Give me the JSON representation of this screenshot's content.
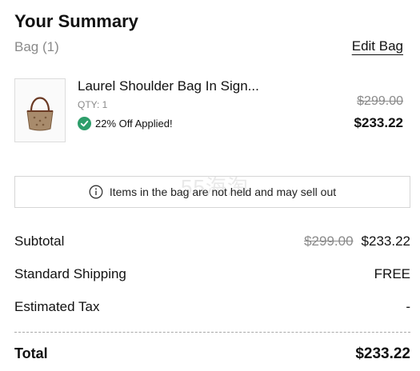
{
  "summary": {
    "title": "Your Summary",
    "bag_count_label": "Bag (1)",
    "edit_bag_label": "Edit Bag"
  },
  "item": {
    "name": "Laurel Shoulder Bag In Sign...",
    "qty_label": "QTY: 1",
    "discount_label": "22% Off Applied!",
    "original_price": "$299.00",
    "sale_price": "$233.22",
    "image_icon": "shoulder-bag-thumbnail"
  },
  "notice": {
    "text": "Items in the bag are not held and may sell out",
    "icon": "info-icon"
  },
  "totals": {
    "subtotal_label": "Subtotal",
    "subtotal_original": "$299.00",
    "subtotal_value": "$233.22",
    "shipping_label": "Standard Shipping",
    "shipping_value": "FREE",
    "tax_label": "Estimated Tax",
    "tax_value": "-",
    "total_label": "Total",
    "total_value": "$233.22"
  },
  "watermark": "55海淘",
  "colors": {
    "accent_green": "#2e9e6b",
    "muted_text": "#8a8a8a",
    "border": "#d6d6d6"
  }
}
